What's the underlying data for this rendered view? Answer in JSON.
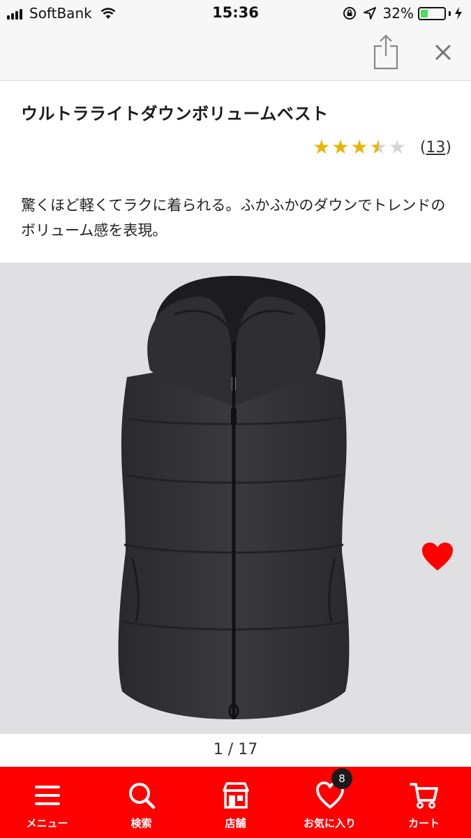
{
  "status_bar": {
    "carrier": "SoftBank",
    "time": "15:36",
    "battery_percent": "32%",
    "battery_level": 0.32
  },
  "browser": {
    "share_icon": "share-icon",
    "close_icon": "close-icon"
  },
  "product": {
    "title": "ウルトラライトダウンボリュームベスト",
    "rating": 3.5,
    "review_count": "13",
    "review_open": "(",
    "review_close": ")",
    "description": "驚くほど軽くてラクに着られる。ふかふかのダウンでトレンドのボリューム感を表現。",
    "favorite_icon": "heart-icon",
    "favorite_color": "#ff0000"
  },
  "gallery": {
    "pager": "1 / 17",
    "image_alt_icon": "vest-image"
  },
  "bottom_nav": {
    "background": "#ff0000",
    "items": [
      {
        "label": "メニュー",
        "icon": "menu-icon"
      },
      {
        "label": "検索",
        "icon": "search-icon"
      },
      {
        "label": "店舗",
        "icon": "store-icon"
      },
      {
        "label": "お気に入り",
        "icon": "heart-icon",
        "badge": "8"
      },
      {
        "label": "カート",
        "icon": "cart-icon"
      }
    ]
  }
}
